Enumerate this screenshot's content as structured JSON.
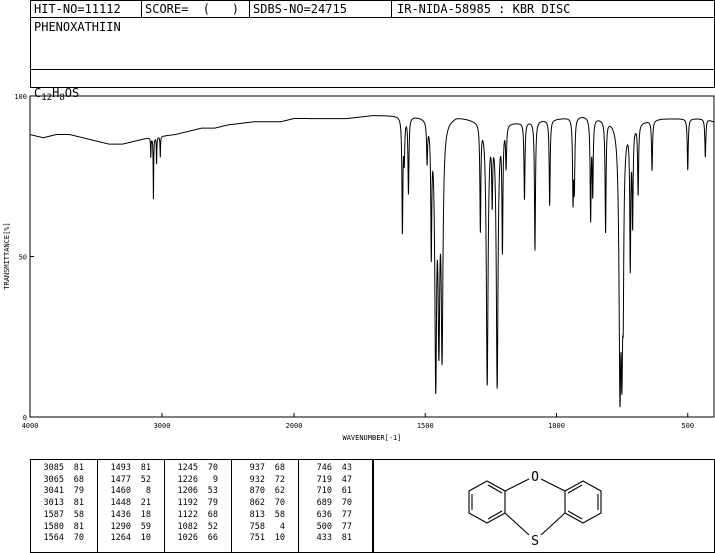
{
  "header": {
    "hit_no": "HIT-NO=11112",
    "score": "SCORE=  (   )",
    "sdbs_no": "SDBS-NO=24715",
    "ir_nida": "IR-NIDA-58985 : KBR DISC"
  },
  "compound": {
    "name": "PHENOXATHIIN",
    "formula_c": "C",
    "formula_c_sub": "12",
    "formula_h": "H",
    "formula_h_sub": "8",
    "formula_rest": "OS"
  },
  "structure": {
    "atom_top": "O",
    "atom_bottom": "S"
  },
  "chart_data": {
    "type": "line",
    "xlabel": "WAVENUMBER[-1]",
    "ylabel": "TRANSMITTANCE[%]",
    "xlim": [
      4000,
      400
    ],
    "ylim": [
      0,
      100
    ],
    "x_ticks": [
      4000,
      3000,
      2000,
      1500,
      1000,
      500
    ],
    "y_ticks": [
      0,
      50,
      100
    ],
    "x_tick_labels": [
      "4000",
      "3000",
      "2000",
      "1500",
      "1000",
      "500"
    ],
    "y_tick_labels": [
      "0",
      "50",
      "100"
    ],
    "baseline": [
      [
        4000,
        88
      ],
      [
        3900,
        87
      ],
      [
        3800,
        88
      ],
      [
        3700,
        88
      ],
      [
        3600,
        87
      ],
      [
        3500,
        86
      ],
      [
        3400,
        85
      ],
      [
        3300,
        85
      ],
      [
        3200,
        86
      ],
      [
        3100,
        87
      ],
      [
        2900,
        88
      ],
      [
        2800,
        89
      ],
      [
        2700,
        90
      ],
      [
        2600,
        90
      ],
      [
        2500,
        91
      ],
      [
        2300,
        92
      ],
      [
        2100,
        92
      ],
      [
        2000,
        93
      ],
      [
        1900,
        93
      ],
      [
        1800,
        93
      ],
      [
        1700,
        94
      ],
      [
        1650,
        94
      ],
      [
        1620,
        94
      ],
      [
        1500,
        94
      ],
      [
        1440,
        93
      ],
      [
        1380,
        94
      ],
      [
        1320,
        93
      ],
      [
        1280,
        93
      ],
      [
        1150,
        92
      ],
      [
        1000,
        93
      ],
      [
        900,
        94
      ],
      [
        800,
        93
      ],
      [
        700,
        92
      ],
      [
        600,
        93
      ],
      [
        500,
        93
      ],
      [
        430,
        93
      ],
      [
        400,
        92
      ]
    ],
    "peaks": [
      {
        "x": 3085,
        "y": 81
      },
      {
        "x": 3065,
        "y": 68
      },
      {
        "x": 3041,
        "y": 79
      },
      {
        "x": 3013,
        "y": 81
      },
      {
        "x": 1587,
        "y": 58
      },
      {
        "x": 1580,
        "y": 81
      },
      {
        "x": 1564,
        "y": 70
      },
      {
        "x": 1493,
        "y": 81
      },
      {
        "x": 1477,
        "y": 52
      },
      {
        "x": 1460,
        "y": 8
      },
      {
        "x": 1448,
        "y": 21
      },
      {
        "x": 1436,
        "y": 18
      },
      {
        "x": 1290,
        "y": 59
      },
      {
        "x": 1264,
        "y": 10
      },
      {
        "x": 1245,
        "y": 70
      },
      {
        "x": 1226,
        "y": 9
      },
      {
        "x": 1206,
        "y": 53
      },
      {
        "x": 1192,
        "y": 79
      },
      {
        "x": 1122,
        "y": 68
      },
      {
        "x": 1082,
        "y": 52
      },
      {
        "x": 1026,
        "y": 66
      },
      {
        "x": 937,
        "y": 68
      },
      {
        "x": 932,
        "y": 72
      },
      {
        "x": 870,
        "y": 62
      },
      {
        "x": 862,
        "y": 70
      },
      {
        "x": 813,
        "y": 58
      },
      {
        "x": 758,
        "y": 4
      },
      {
        "x": 751,
        "y": 10
      },
      {
        "x": 746,
        "y": 43
      },
      {
        "x": 719,
        "y": 47
      },
      {
        "x": 710,
        "y": 61
      },
      {
        "x": 689,
        "y": 70
      },
      {
        "x": 636,
        "y": 77
      },
      {
        "x": 500,
        "y": 77
      },
      {
        "x": 433,
        "y": 81
      }
    ]
  },
  "peak_table": [
    [
      [
        "3085",
        "81"
      ],
      [
        "3065",
        "68"
      ],
      [
        "3041",
        "79"
      ],
      [
        "3013",
        "81"
      ],
      [
        "1587",
        "58"
      ],
      [
        "1580",
        "81"
      ],
      [
        "1564",
        "70"
      ]
    ],
    [
      [
        "1493",
        "81"
      ],
      [
        "1477",
        "52"
      ],
      [
        "1460",
        "8"
      ],
      [
        "1448",
        "21"
      ],
      [
        "1436",
        "18"
      ],
      [
        "1290",
        "59"
      ],
      [
        "1264",
        "10"
      ]
    ],
    [
      [
        "1245",
        "70"
      ],
      [
        "1226",
        "9"
      ],
      [
        "1206",
        "53"
      ],
      [
        "1192",
        "79"
      ],
      [
        "1122",
        "68"
      ],
      [
        "1082",
        "52"
      ],
      [
        "1026",
        "66"
      ]
    ],
    [
      [
        "937",
        "68"
      ],
      [
        "932",
        "72"
      ],
      [
        "870",
        "62"
      ],
      [
        "862",
        "70"
      ],
      [
        "813",
        "58"
      ],
      [
        "758",
        "4"
      ],
      [
        "751",
        "10"
      ]
    ],
    [
      [
        "746",
        "43"
      ],
      [
        "719",
        "47"
      ],
      [
        "710",
        "61"
      ],
      [
        "689",
        "70"
      ],
      [
        "636",
        "77"
      ],
      [
        "500",
        "77"
      ],
      [
        "433",
        "81"
      ]
    ]
  ]
}
